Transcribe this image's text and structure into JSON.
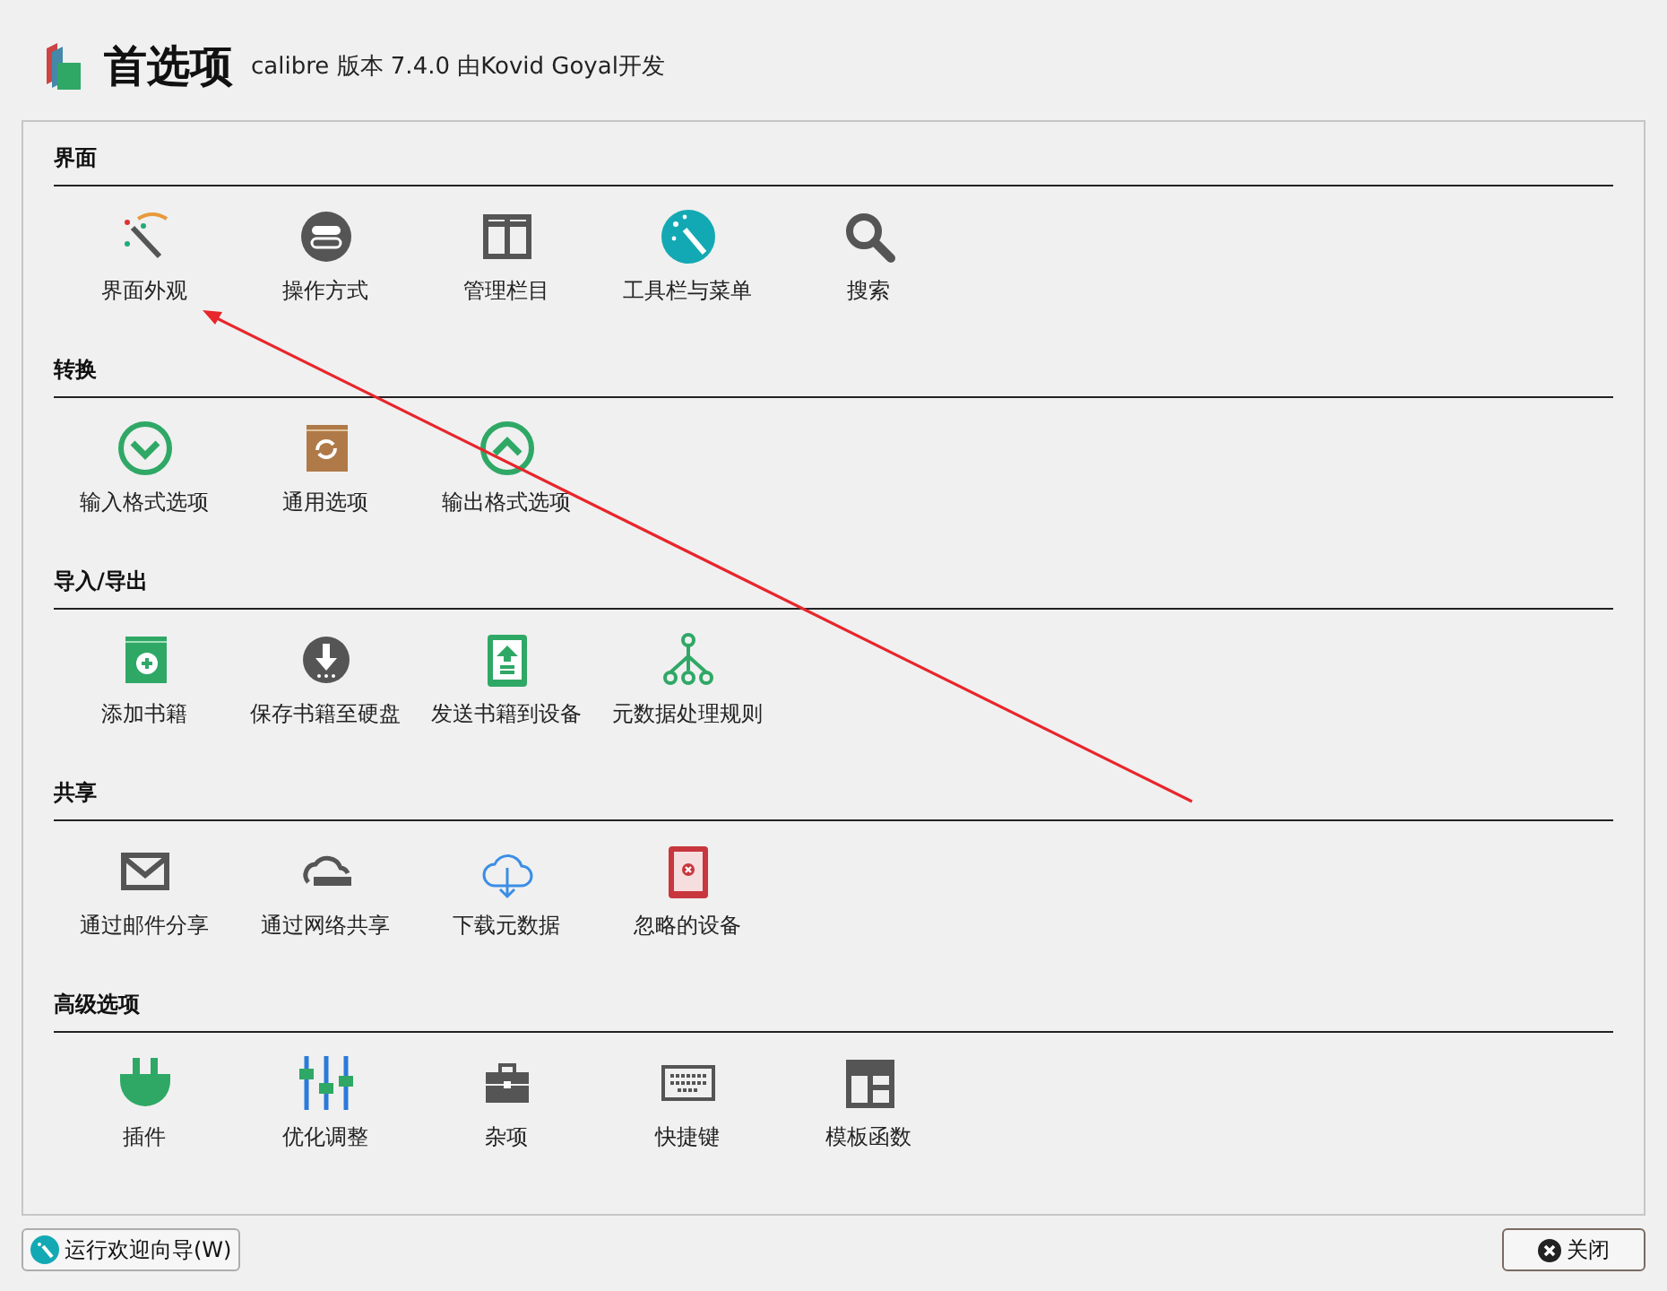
{
  "window": {
    "title": "首选项",
    "subtitle": "calibre 版本 7.4.0 由Kovid Goyal开发"
  },
  "sections": [
    {
      "title": "界面",
      "items": [
        {
          "label": "界面外观"
        },
        {
          "label": "操作方式"
        },
        {
          "label": "管理栏目"
        },
        {
          "label": "工具栏与菜单"
        },
        {
          "label": "搜索"
        }
      ]
    },
    {
      "title": "转换",
      "items": [
        {
          "label": "输入格式选项"
        },
        {
          "label": "通用选项"
        },
        {
          "label": "输出格式选项"
        }
      ]
    },
    {
      "title": "导入/导出",
      "items": [
        {
          "label": "添加书籍"
        },
        {
          "label": "保存书籍至硬盘"
        },
        {
          "label": "发送书籍到设备"
        },
        {
          "label": "元数据处理规则"
        }
      ]
    },
    {
      "title": "共享",
      "items": [
        {
          "label": "通过邮件分享"
        },
        {
          "label": "通过网络共享"
        },
        {
          "label": "下载元数据"
        },
        {
          "label": "忽略的设备"
        }
      ]
    },
    {
      "title": "高级选项",
      "items": [
        {
          "label": "插件"
        },
        {
          "label": "优化调整"
        },
        {
          "label": "杂项"
        },
        {
          "label": "快捷键"
        },
        {
          "label": "模板函数"
        }
      ]
    }
  ],
  "buttons": [
    {
      "label": "运行欢迎向导(W)"
    },
    {
      "label": "关闭"
    }
  ]
}
